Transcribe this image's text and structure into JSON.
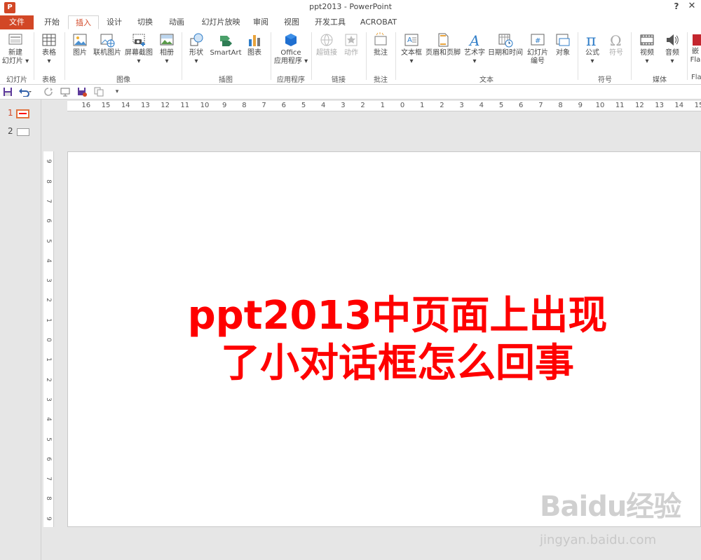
{
  "window": {
    "title": "ppt2013 - PowerPoint",
    "app_icon": "P",
    "help": "?",
    "close": "✕"
  },
  "tabs": [
    {
      "label": "文件",
      "state": "file"
    },
    {
      "label": "开始",
      "state": ""
    },
    {
      "label": "插入",
      "state": "active"
    },
    {
      "label": "设计",
      "state": ""
    },
    {
      "label": "切换",
      "state": ""
    },
    {
      "label": "动画",
      "state": ""
    },
    {
      "label": "幻灯片放映",
      "state": ""
    },
    {
      "label": "审阅",
      "state": ""
    },
    {
      "label": "视图",
      "state": ""
    },
    {
      "label": "开发工具",
      "state": ""
    },
    {
      "label": "ACROBAT",
      "state": ""
    }
  ],
  "ribbon": {
    "buttons": [
      {
        "label": "新建\n幻灯片 ▾",
        "icon": "new-slide-icon",
        "disabled": false
      },
      {
        "label": "表格\n▾",
        "icon": "table-icon",
        "disabled": false
      },
      {
        "label": "图片",
        "icon": "picture-icon",
        "disabled": false
      },
      {
        "label": "联机图片",
        "icon": "online-picture-icon",
        "disabled": false
      },
      {
        "label": "屏幕截图\n▾",
        "icon": "screenshot-icon",
        "disabled": false
      },
      {
        "label": "相册\n▾",
        "icon": "photo-album-icon",
        "disabled": false
      },
      {
        "label": "形状\n▾",
        "icon": "shapes-icon",
        "disabled": false
      },
      {
        "label": "SmartArt",
        "icon": "smartart-icon",
        "disabled": false
      },
      {
        "label": "图表",
        "icon": "chart-icon",
        "disabled": false
      },
      {
        "label": "Office\n应用程序 ▾",
        "icon": "office-apps-icon",
        "disabled": false
      },
      {
        "label": "超链接",
        "icon": "hyperlink-icon",
        "disabled": true
      },
      {
        "label": "动作",
        "icon": "action-icon",
        "disabled": true
      },
      {
        "label": "批注",
        "icon": "comment-icon",
        "disabled": false
      },
      {
        "label": "文本框\n▾",
        "icon": "textbox-icon",
        "disabled": false
      },
      {
        "label": "页眉和页脚",
        "icon": "header-footer-icon",
        "disabled": false
      },
      {
        "label": "艺术字\n▾",
        "icon": "wordart-icon",
        "disabled": false
      },
      {
        "label": "日期和时间",
        "icon": "date-time-icon",
        "disabled": false
      },
      {
        "label": "幻灯片\n编号",
        "icon": "slide-number-icon",
        "disabled": false
      },
      {
        "label": "对象",
        "icon": "object-icon",
        "disabled": false
      },
      {
        "label": "公式\n▾",
        "icon": "equation-icon",
        "disabled": false
      },
      {
        "label": "符号",
        "icon": "symbol-icon",
        "disabled": true
      },
      {
        "label": "视频\n▾",
        "icon": "video-icon",
        "disabled": false
      },
      {
        "label": "音频\n▾",
        "icon": "audio-icon",
        "disabled": false
      },
      {
        "label": "嵌\nFla",
        "icon": "flash-icon",
        "disabled": false
      }
    ],
    "groups": [
      "幻灯片",
      "表格",
      "图像",
      "插图",
      "应用程序",
      "链接",
      "批注",
      "文本",
      "符号",
      "媒体",
      "Fla"
    ]
  },
  "rulers": {
    "horizontal": [
      "16",
      "15",
      "14",
      "13",
      "12",
      "11",
      "10",
      "9",
      "8",
      "7",
      "6",
      "5",
      "4",
      "3",
      "2",
      "1",
      "0",
      "1",
      "2",
      "3",
      "4",
      "5",
      "6",
      "7",
      "8",
      "9",
      "10",
      "11",
      "12",
      "13",
      "14",
      "15"
    ],
    "vertical": [
      "9",
      "8",
      "7",
      "6",
      "5",
      "4",
      "3",
      "2",
      "1",
      "0",
      "1",
      "2",
      "3",
      "4",
      "5",
      "6",
      "7",
      "8",
      "9"
    ]
  },
  "thumbnails": [
    {
      "number": "1",
      "selected": true
    },
    {
      "number": "2",
      "selected": false
    }
  ],
  "slide": {
    "text_line1": "ppt2013中页面上出现",
    "text_line2": "了小对话框怎么回事",
    "text_color": "#ff0000"
  },
  "watermark": {
    "logo": "Baidu经验",
    "url": "jingyan.baidu.com"
  },
  "colors": {
    "accent": "#d24726"
  }
}
